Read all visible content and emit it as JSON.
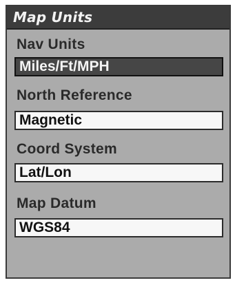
{
  "window": {
    "title": "Map Units"
  },
  "settings": [
    {
      "label": "Nav Units",
      "value": "Miles/Ft/MPH",
      "selected": true
    },
    {
      "label": "North Reference",
      "value": "Magnetic",
      "selected": false
    },
    {
      "label": "Coord System",
      "value": "Lat/Lon",
      "selected": false
    },
    {
      "label": "Map Datum",
      "value": "WGS84",
      "selected": false
    }
  ],
  "colors": {
    "screen_background": "#ababab",
    "title_bar": "#3c3c3c",
    "selected_field": "#464646",
    "field": "#f7f7f7"
  }
}
